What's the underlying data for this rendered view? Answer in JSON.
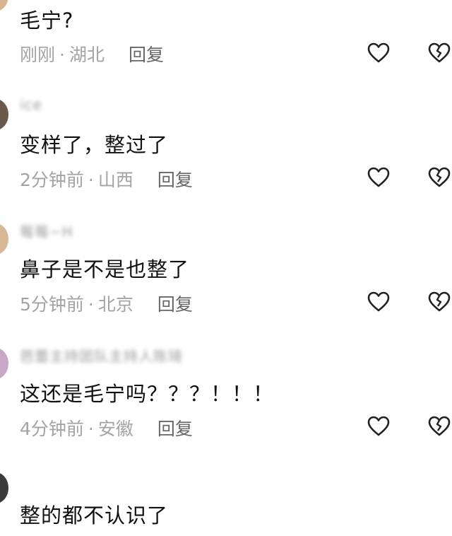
{
  "comments": [
    {
      "username": "",
      "text": "毛宁?",
      "time": "刚刚",
      "location": "湖北",
      "reply": "回复",
      "avatar_color": "#d9b38c"
    },
    {
      "username": "ice",
      "text": "变样了，整过了",
      "time": "2分钟前",
      "location": "山西",
      "reply": "回复",
      "avatar_color": "#6b5a4a"
    },
    {
      "username": "莓莓~H",
      "text": "鼻子是不是也整了",
      "time": "5分钟前",
      "location": "北京",
      "reply": "回复",
      "avatar_color": "#d8b892"
    },
    {
      "username": "芭蕾主持团队主持人陈琦",
      "text": "这还是毛宁吗？？？！！！",
      "time": "4分钟前",
      "location": "安徽",
      "reply": "回复",
      "avatar_color": "#c9a7c9"
    },
    {
      "username": "",
      "text": "整的都不认识了",
      "time": "",
      "location": "",
      "reply": "",
      "avatar_color": "#3a3a3a"
    }
  ],
  "icons": {
    "like": "heart-outline-icon",
    "dislike": "broken-heart-icon"
  },
  "colors": {
    "meta_text": "#a3a3a3",
    "reply_text": "#666666",
    "icon_stroke": "#222222"
  }
}
